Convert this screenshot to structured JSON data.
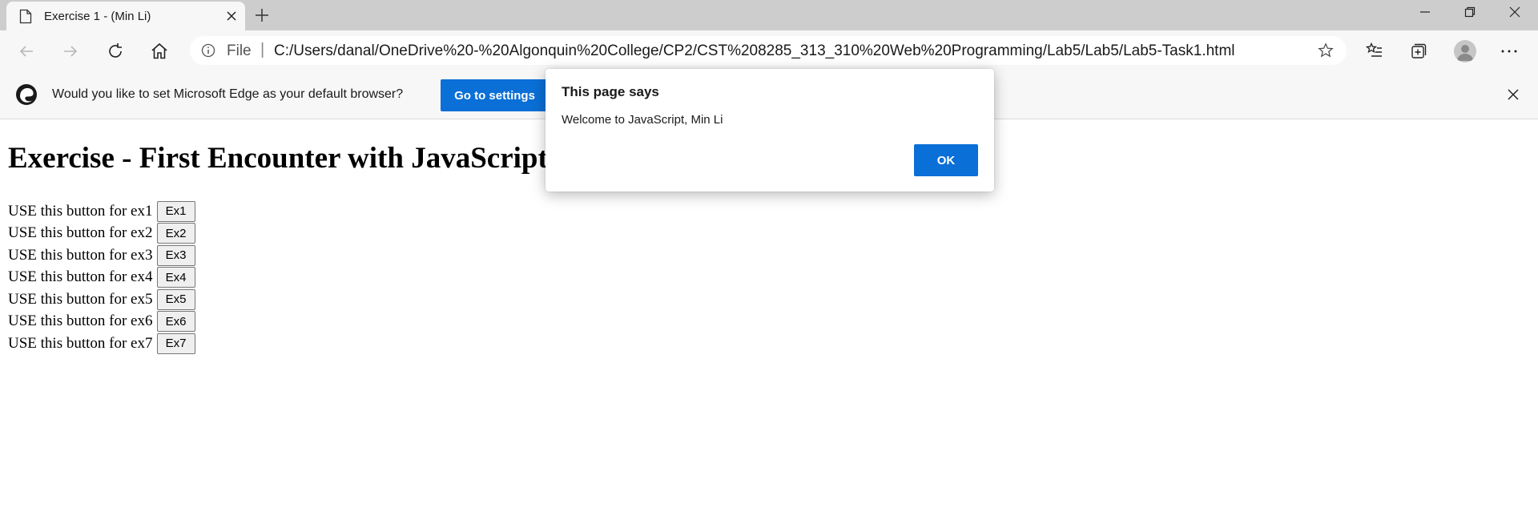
{
  "browser": {
    "tab": {
      "title": "Exercise 1 - (Min Li)",
      "icon": "page-icon"
    },
    "url_scheme": "File",
    "url": "C:/Users/danal/OneDrive%20-%20Algonquin%20College/CP2/CST%208285_313_310%20Web%20Programming/Lab5/Lab5/Lab5-Task1.html"
  },
  "infobar": {
    "message": "Would you like to set Microsoft Edge as your default browser?",
    "button_label": "Go to settings"
  },
  "page": {
    "heading": "Exercise - First Encounter with JavaScript",
    "rows": [
      {
        "label": "USE this button for ex1",
        "button": "Ex1"
      },
      {
        "label": "USE this button for ex2",
        "button": "Ex2"
      },
      {
        "label": "USE this button for ex3",
        "button": "Ex3"
      },
      {
        "label": "USE this button for ex4",
        "button": "Ex4"
      },
      {
        "label": "USE this button for ex5",
        "button": "Ex5"
      },
      {
        "label": "USE this button for ex6",
        "button": "Ex6"
      },
      {
        "label": "USE this button for ex7",
        "button": "Ex7"
      }
    ]
  },
  "dialog": {
    "title": "This page says",
    "message": "Welcome to JavaScript, Min Li",
    "ok_label": "OK"
  },
  "colors": {
    "accent": "#0a6fd6",
    "chrome": "#f7f7f7",
    "tabstrip": "#cdcdcd"
  }
}
